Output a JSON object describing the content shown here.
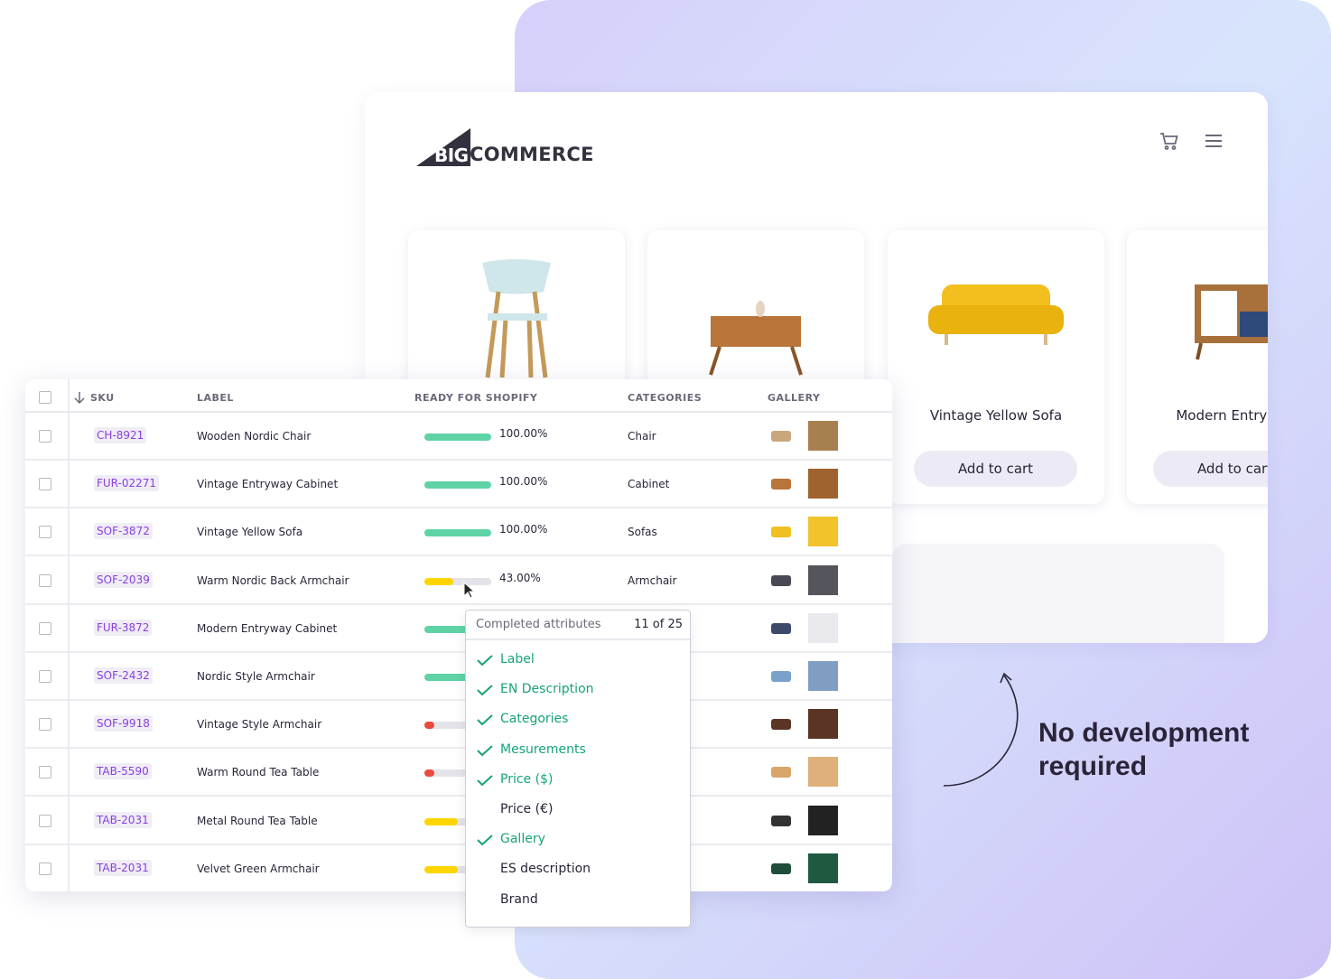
{
  "store": {
    "brand": "BIGCOMMERCE",
    "logo_big": "BIG",
    "logo_rest": "COMMERCE",
    "products": [
      {
        "title": "",
        "button": "",
        "image": "wooden-chair"
      },
      {
        "title": "",
        "button": "",
        "image": "entryway-cabinet"
      },
      {
        "title": "Vintage Yellow Sofa",
        "button": "Add to cart",
        "image": "yellow-sofa"
      },
      {
        "title": "Modern Entryway",
        "button": "Add to cart",
        "image": "modern-cabinet"
      }
    ]
  },
  "table": {
    "headers": {
      "sku": "SKU",
      "label": "LABEL",
      "ready": "READY FOR SHOPIFY",
      "categories": "CATEGORIES",
      "gallery": "GALLERY"
    },
    "rows": [
      {
        "sku": "CH-8921",
        "label": "Wooden Nordic Chair",
        "progress": 100,
        "pct": "100.00%",
        "category": "Chair",
        "color": "#5fd3a5",
        "img": [
          "#c9a77a",
          "#a88050"
        ]
      },
      {
        "sku": "FUR-02271",
        "label": "Vintage Entryway Cabinet",
        "progress": 100,
        "pct": "100.00%",
        "category": "Cabinet",
        "color": "#5fd3a5",
        "img": [
          "#b9743a",
          "#a0622e"
        ]
      },
      {
        "sku": "SOF-3872",
        "label": "Vintage Yellow Sofa",
        "progress": 100,
        "pct": "100.00%",
        "category": "Sofas",
        "color": "#5fd3a5",
        "img": [
          "#f0c020",
          "#f2c32a"
        ]
      },
      {
        "sku": "SOF-2039",
        "label": "Warm Nordic Back Armchair",
        "progress": 43,
        "pct": "43.00%",
        "category": "Armchair",
        "color": "#ffd500",
        "img": [
          "#4a4a55",
          "#55555e"
        ]
      },
      {
        "sku": "FUR-3872",
        "label": "Modern Entryway Cabinet",
        "progress": 100,
        "pct": "",
        "category": "",
        "color": "#5fd3a5",
        "img": [
          "#3b4a6b",
          "#e9e9ee"
        ]
      },
      {
        "sku": "SOF-2432",
        "label": "Nordic Style Armchair",
        "progress": 100,
        "pct": "",
        "category": "",
        "color": "#5fd3a5",
        "img": [
          "#7aa0cc",
          "#7f9ec2"
        ]
      },
      {
        "sku": "SOF-9918",
        "label": "Vintage Style Armchair",
        "progress": 15,
        "pct": "",
        "category": "",
        "color": "#ea4b3f",
        "img": [
          "#5a3525",
          "#5b3426"
        ]
      },
      {
        "sku": "TAB-5590",
        "label": "Warm Round Tea Table",
        "progress": 15,
        "pct": "",
        "category": "",
        "color": "#ea4b3f",
        "img": [
          "#d9a56a",
          "#dfb07a"
        ]
      },
      {
        "sku": "TAB-2031",
        "label": "Metal Round Tea Table",
        "progress": 50,
        "pct": "",
        "category": "",
        "color": "#ffd500",
        "img": [
          "#333",
          "#222"
        ]
      },
      {
        "sku": "TAB-2031",
        "label": "Velvet Green Armchair",
        "progress": 50,
        "pct": "",
        "category": "",
        "color": "#ffd500",
        "img": [
          "#1e4d3a",
          "#1f5a40"
        ]
      }
    ]
  },
  "tooltip": {
    "title": "Completed attributes",
    "count": "11 of 25",
    "items": [
      {
        "label": "Label",
        "done": true
      },
      {
        "label": "EN Description",
        "done": true
      },
      {
        "label": "Categories",
        "done": true
      },
      {
        "label": "Mesurements",
        "done": true
      },
      {
        "label": "Price ($)",
        "done": true
      },
      {
        "label": "Price (€)",
        "done": false
      },
      {
        "label": "Gallery",
        "done": true
      },
      {
        "label": "ES description",
        "done": false
      },
      {
        "label": "Brand",
        "done": false
      }
    ]
  },
  "cta": {
    "line1": "No development",
    "line2": "required"
  },
  "colors": {
    "accent": "#8a3fe0",
    "green": "#5fd3a5",
    "yellow": "#ffd500",
    "red": "#ea4b3f",
    "check": "#16a37a"
  }
}
